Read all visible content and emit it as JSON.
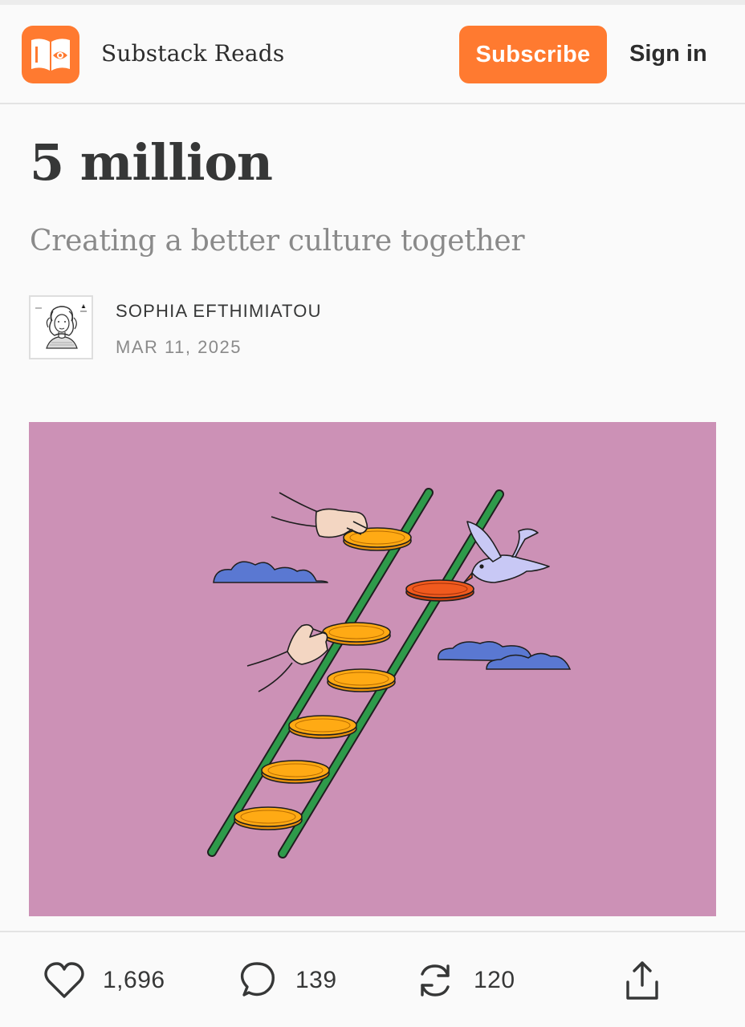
{
  "header": {
    "publication_name": "Substack Reads",
    "subscribe_label": "Subscribe",
    "signin_label": "Sign in",
    "logo_icon": "open-book-eye-icon"
  },
  "post": {
    "title": "5 million",
    "subtitle": "Creating a better culture together",
    "author": "SOPHIA EFTHIMIATOU",
    "date": "MAR 11, 2025",
    "hero_illustration": "ladder-of-coins-with-hands-bird-and-clouds"
  },
  "actions": {
    "likes": "1,696",
    "comments": "139",
    "restacks": "120",
    "icons": [
      "heart-icon",
      "comment-icon",
      "restack-icon",
      "share-icon"
    ]
  },
  "colors": {
    "accent": "#ff7a30",
    "hero_background": "#cc91b6",
    "ladder": "#2e9a4a",
    "coin": "#ffaa14",
    "coin_red": "#f05a1e",
    "cloud": "#5a78d2",
    "bird": "#c8c8f5"
  }
}
